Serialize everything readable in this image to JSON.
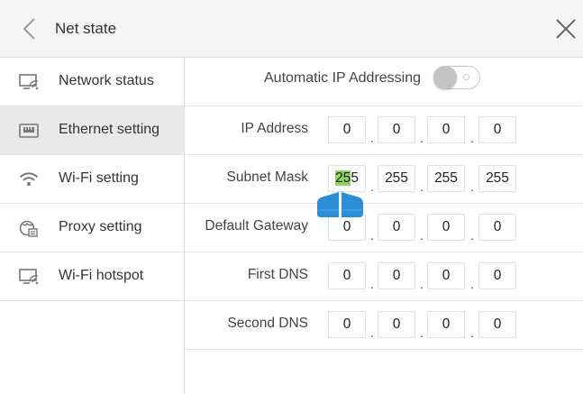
{
  "header": {
    "title": "Net state"
  },
  "sidebar": {
    "items": [
      {
        "label": "Network status",
        "icon": "monitor-wifi-icon",
        "active": false
      },
      {
        "label": "Ethernet setting",
        "icon": "ethernet-port-icon",
        "active": true
      },
      {
        "label": "Wi-Fi setting",
        "icon": "wifi-icon",
        "active": false
      },
      {
        "label": "Proxy setting",
        "icon": "globe-proxy-icon",
        "active": false
      },
      {
        "label": "Wi-Fi hotspot",
        "icon": "monitor-wifi-icon",
        "active": false
      }
    ]
  },
  "main": {
    "auto_ip": {
      "label": "Automatic IP Addressing",
      "enabled": false
    },
    "fields": [
      {
        "label": "IP Address",
        "octets": [
          "0",
          "0",
          "0",
          "0"
        ]
      },
      {
        "label": "Subnet Mask",
        "octets": [
          "255",
          "255",
          "255",
          "255"
        ],
        "selected_text": "25"
      },
      {
        "label": "Default Gateway",
        "octets": [
          "0",
          "0",
          "0",
          "0"
        ]
      },
      {
        "label": "First DNS",
        "octets": [
          "0",
          "0",
          "0",
          "0"
        ]
      },
      {
        "label": "Second DNS",
        "octets": [
          "0",
          "0",
          "0",
          "0"
        ]
      }
    ],
    "separator": "."
  },
  "colors": {
    "header_bg": "#f5f5f5",
    "active_item_bg": "#e9e9e9",
    "selection_highlight": "#8fd45e",
    "text_handle": "#2a8fd6"
  }
}
